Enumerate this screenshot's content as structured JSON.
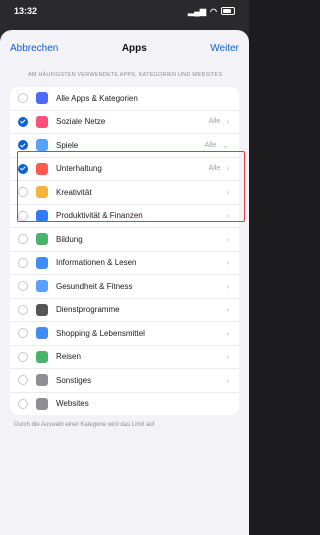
{
  "status": {
    "time": "13:32"
  },
  "nav": {
    "cancel": "Abbrechen",
    "title": "Apps",
    "next": "Weiter"
  },
  "caption": "AM HÄUFIGSTEN VERWENDETE APPS, KATEGORIEN UND WEBSITES",
  "rows": [
    {
      "label": "Alle Apps & Kategorien",
      "checked": false,
      "icon": "stack-icon",
      "color": "#4a6cf7",
      "value": "",
      "chevron": ""
    },
    {
      "label": "Soziale Netze",
      "checked": true,
      "icon": "chat-bubble-icon",
      "color": "#ff4f7a",
      "value": "Alle",
      "chevron": ">"
    },
    {
      "label": "Spiele",
      "checked": true,
      "icon": "rocket-icon",
      "color": "#5aa0ff",
      "value": "Alle",
      "chevron": "v"
    },
    {
      "label": "Unterhaltung",
      "checked": true,
      "icon": "popcorn-icon",
      "color": "#ff5a52",
      "value": "Alle",
      "chevron": ">"
    },
    {
      "label": "Kreativität",
      "checked": false,
      "icon": "palette-icon",
      "color": "#f2b43a",
      "value": "",
      "chevron": ">"
    },
    {
      "label": "Produktivität & Finanzen",
      "checked": false,
      "icon": "paper-plane-icon",
      "color": "#2f7bf6",
      "value": "",
      "chevron": ">"
    },
    {
      "label": "Bildung",
      "checked": false,
      "icon": "globe-icon",
      "color": "#49b36b",
      "value": "",
      "chevron": ">"
    },
    {
      "label": "Informationen & Lesen",
      "checked": false,
      "icon": "book-icon",
      "color": "#3f8cf3",
      "value": "",
      "chevron": ">"
    },
    {
      "label": "Gesundheit & Fitness",
      "checked": false,
      "icon": "bicycle-icon",
      "color": "#5aa0ff",
      "value": "",
      "chevron": ">"
    },
    {
      "label": "Dienstprogramme",
      "checked": false,
      "icon": "calculator-icon",
      "color": "#555555",
      "value": "",
      "chevron": ">"
    },
    {
      "label": "Shopping & Lebensmittel",
      "checked": false,
      "icon": "shopping-bag-icon",
      "color": "#3f8cf3",
      "value": "",
      "chevron": ">"
    },
    {
      "label": "Reisen",
      "checked": false,
      "icon": "palm-tree-icon",
      "color": "#49b36b",
      "value": "",
      "chevron": ">"
    },
    {
      "label": "Sonstiges",
      "checked": false,
      "icon": "ellipsis-icon",
      "color": "#8e8e93",
      "value": "",
      "chevron": ">"
    },
    {
      "label": "Websites",
      "checked": false,
      "icon": "compass-icon",
      "color": "#8e8e93",
      "value": "",
      "chevron": ""
    }
  ],
  "footer": "Durch die Auswahl einer Kategorie wird das Limit auf"
}
